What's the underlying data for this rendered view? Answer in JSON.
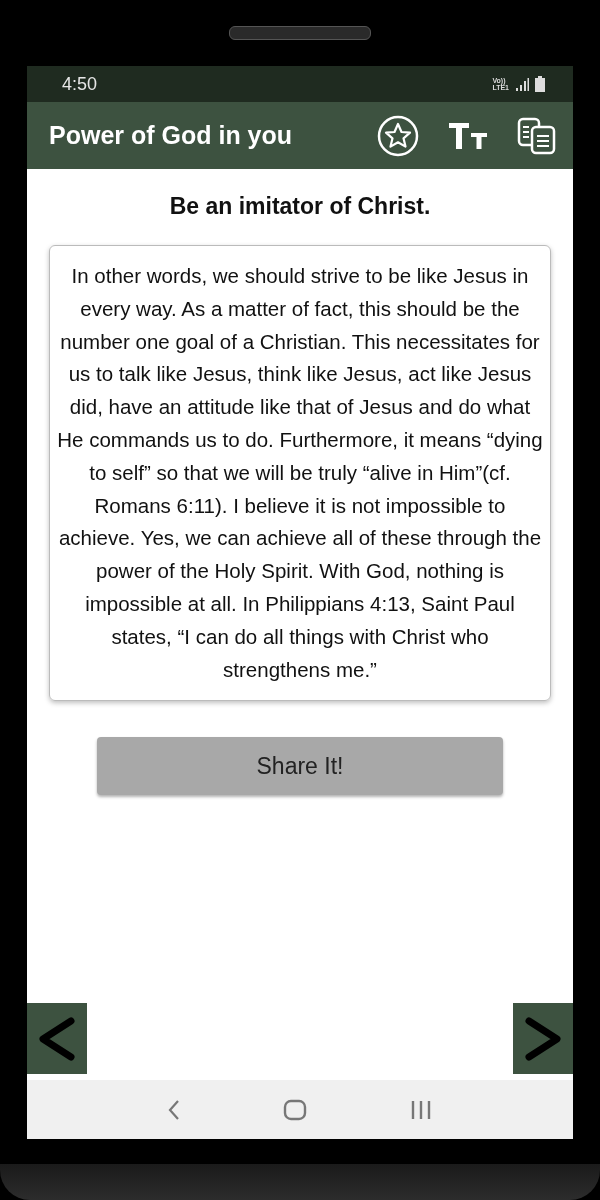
{
  "status_bar": {
    "time": "4:50",
    "network_top": "Vo))",
    "network_bottom": "LTE1"
  },
  "app_bar": {
    "title": "Power of God in you",
    "actions": [
      {
        "kind": "favorite"
      },
      {
        "kind": "text_size"
      },
      {
        "kind": "copy"
      }
    ]
  },
  "heading": "Be an imitator of Christ.",
  "body": "In other words, we should strive to be like Jesus in every way. As a matter of fact, this should be the number one goal of a Christian. This necessitates for us to talk like Jesus, think like Jesus, act like Jesus did, have an attitude like that of Jesus and do what He commands us to do. Furthermore, it means “dying to self” so that we will be truly “alive in Him”(cf. Romans 6:11). I believe it is not impossible to achieve. Yes, we can achieve all of these through the power of the Holy Spirit. With God, nothing is impossible at all. In Philippians 4:13, Saint Paul states, “I can do all things with Christ who strengthens me.”",
  "share_button": "Share It!",
  "pager": [
    {
      "kind": "previous"
    },
    {
      "kind": "next"
    }
  ],
  "system_nav": [
    {
      "kind": "back"
    },
    {
      "kind": "home"
    },
    {
      "kind": "recents"
    }
  ]
}
